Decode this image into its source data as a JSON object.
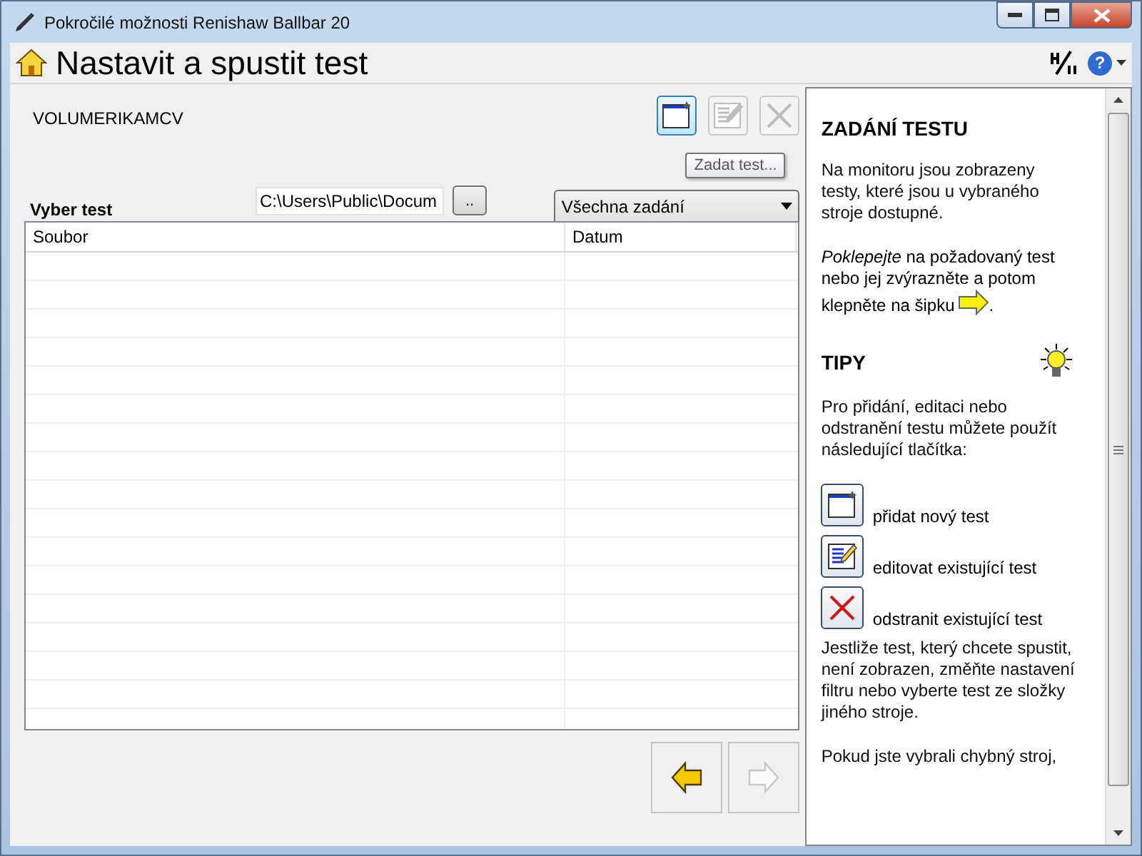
{
  "window": {
    "title": "Pokročilé možnosti Renishaw Ballbar 20"
  },
  "header": {
    "title": "Nastavit a spustit test",
    "help_glyph": "?"
  },
  "machine": "VOLUMERIKAMCV",
  "toolbar": [
    {
      "kind": "new",
      "disabled": false
    },
    {
      "kind": "edit",
      "disabled": true
    },
    {
      "kind": "delete",
      "disabled": true
    }
  ],
  "tooltip": "Zadat test...",
  "select_label": "Vyber test",
  "path_field": {
    "value": "C:\\Users\\Public\\Docum"
  },
  "browse_button": "..",
  "filter": {
    "value": "Všechna zadání"
  },
  "table": {
    "columns": [
      "Soubor",
      "Datum"
    ]
  },
  "nav": [
    {
      "kind": "back",
      "disabled": false
    },
    {
      "kind": "forward",
      "disabled": true
    }
  ],
  "help": [
    {
      "kind": "heading",
      "text": "ZADÁNÍ TESTU"
    },
    {
      "kind": "para",
      "text": "Na monitoru jsou zobrazeny testy, které jsou u vybraného stroje dostupné."
    },
    {
      "kind": "para_arrow",
      "text": "*Poklepejte* na požadovaný test nebo jej zvýrazněte a potom",
      "line": "klepněte na šipku",
      "after": "."
    },
    {
      "kind": "heading_bulb",
      "text": "TIPY"
    },
    {
      "kind": "para",
      "text": "Pro přidání, editaci nebo odstranění testu můžete použít následující tlačítka:"
    },
    {
      "kind": "tool_new",
      "text": "přidat nový test"
    },
    {
      "kind": "tool_edit",
      "text": "editovat existující test"
    },
    {
      "kind": "tool_delete",
      "text": "odstranit existující test"
    },
    {
      "kind": "para",
      "text": "Jestliže test, který chcete spustit, není zobrazen, změňte nastavení filtru nebo vyberte test ze složky jiného stroje."
    },
    {
      "kind": "para",
      "text": "Pokud jste vybrali chybný stroj,"
    }
  ]
}
